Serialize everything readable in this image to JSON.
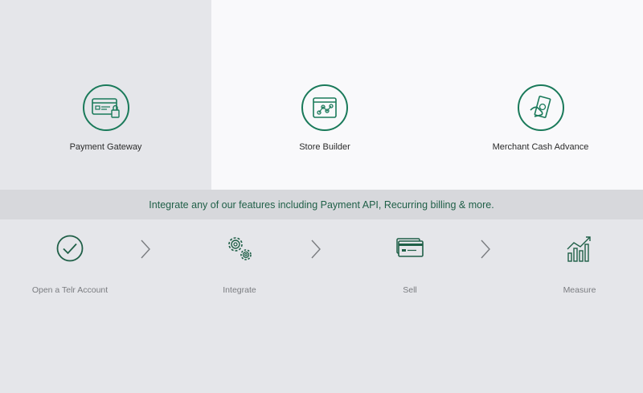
{
  "features": [
    {
      "label": "Payment Gateway",
      "icon": "credit-card-lock-icon"
    },
    {
      "label": "Store Builder",
      "icon": "store-builder-graph-icon"
    },
    {
      "label": "Merchant Cash Advance",
      "icon": "cash-in-hand-icon"
    }
  ],
  "banner": {
    "text": "Integrate any of our features including Payment API, Recurring billing & more."
  },
  "steps": [
    {
      "label": "Open a Telr Account",
      "icon": "check-circle-icon"
    },
    {
      "label": "Integrate",
      "icon": "gears-icon"
    },
    {
      "label": "Sell",
      "icon": "cards-icon"
    },
    {
      "label": "Measure",
      "icon": "bar-chart-growth-icon"
    }
  ],
  "colors": {
    "accent": "#1a7a5a",
    "banner_text": "#1f5f47",
    "muted": "#7a7c80"
  }
}
